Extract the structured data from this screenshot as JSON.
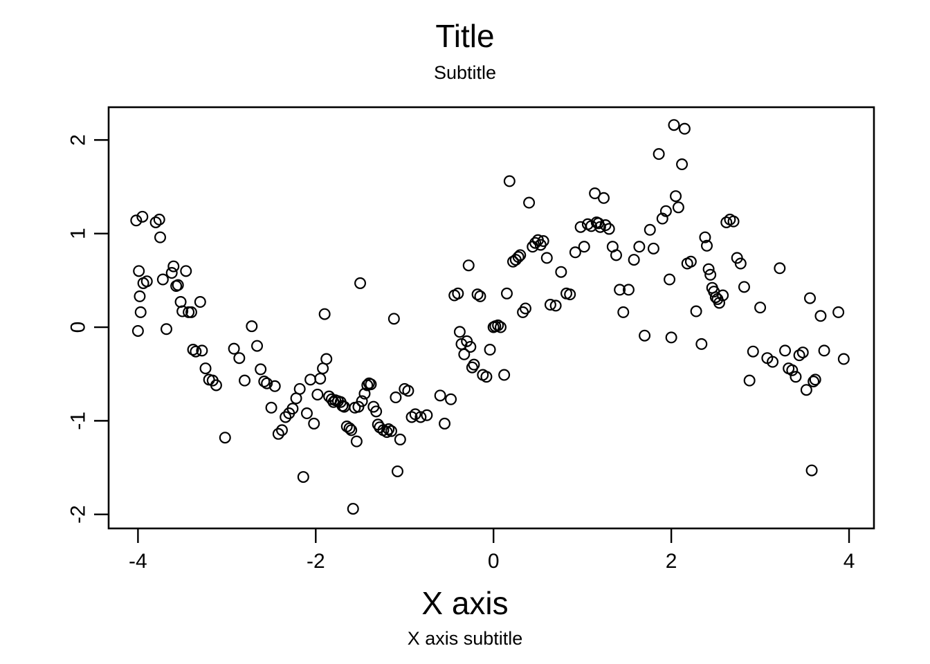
{
  "titles": {
    "main": "Title",
    "sub": "Subtitle",
    "xlab": "X axis",
    "xsublab": "X axis subtitle"
  },
  "colors": {
    "point_stroke": "#000000",
    "axis": "#000000",
    "background": "#ffffff"
  },
  "chart_data": {
    "type": "scatter",
    "title": "Title",
    "subtitle": "Subtitle",
    "xlabel": "X axis",
    "xsublabel": "X axis subtitle",
    "ylabel": "",
    "grid": false,
    "legend": null,
    "marker": "open-circle",
    "xlim": [
      -4.33,
      4.28
    ],
    "ylim": [
      -2.15,
      2.35
    ],
    "xticks": [
      -4,
      -2,
      0,
      2,
      4
    ],
    "yticks": [
      -2,
      -1,
      0,
      1,
      2
    ],
    "xtick_labels": [
      "-4",
      "-2",
      "0",
      "2",
      "4"
    ],
    "ytick_labels": [
      "-2",
      "-1",
      "0",
      "1",
      "2"
    ],
    "n_points": 200,
    "points": [
      [
        -4.02,
        1.14
      ],
      [
        -3.95,
        1.18
      ],
      [
        -3.99,
        0.6
      ],
      [
        -3.94,
        0.47
      ],
      [
        -3.9,
        0.49
      ],
      [
        -3.98,
        0.33
      ],
      [
        -3.97,
        0.16
      ],
      [
        -4.0,
        -0.04
      ],
      [
        -3.8,
        1.12
      ],
      [
        -3.76,
        1.15
      ],
      [
        -3.75,
        0.96
      ],
      [
        -3.72,
        0.51
      ],
      [
        -3.6,
        0.65
      ],
      [
        -3.62,
        0.58
      ],
      [
        -3.57,
        0.44
      ],
      [
        -3.55,
        0.45
      ],
      [
        -3.52,
        0.27
      ],
      [
        -3.5,
        0.17
      ],
      [
        -3.46,
        0.6
      ],
      [
        -3.43,
        0.16
      ],
      [
        -3.4,
        0.16
      ],
      [
        -3.38,
        -0.24
      ],
      [
        -3.35,
        -0.26
      ],
      [
        -3.3,
        0.27
      ],
      [
        -3.28,
        -0.25
      ],
      [
        -3.24,
        -0.44
      ],
      [
        -3.2,
        -0.56
      ],
      [
        -3.16,
        -0.57
      ],
      [
        -3.12,
        -0.62
      ],
      [
        -3.02,
        -1.18
      ],
      [
        -2.92,
        -0.23
      ],
      [
        -2.86,
        -0.33
      ],
      [
        -2.8,
        -0.57
      ],
      [
        -2.72,
        0.01
      ],
      [
        -2.66,
        -0.2
      ],
      [
        -2.62,
        -0.45
      ],
      [
        -2.58,
        -0.58
      ],
      [
        -2.55,
        -0.6
      ],
      [
        -2.5,
        -0.86
      ],
      [
        -2.46,
        -0.63
      ],
      [
        -2.42,
        -1.14
      ],
      [
        -2.38,
        -1.1
      ],
      [
        -2.34,
        -0.96
      ],
      [
        -2.3,
        -0.92
      ],
      [
        -2.26,
        -0.87
      ],
      [
        -2.22,
        -0.76
      ],
      [
        -2.18,
        -0.66
      ],
      [
        -2.14,
        -1.6
      ],
      [
        -2.1,
        -0.92
      ],
      [
        -2.06,
        -0.56
      ],
      [
        -2.02,
        -1.03
      ],
      [
        -1.98,
        -0.72
      ],
      [
        -1.95,
        -0.55
      ],
      [
        -1.92,
        -0.44
      ],
      [
        -1.9,
        0.14
      ],
      [
        -1.88,
        -0.34
      ],
      [
        -1.85,
        -0.74
      ],
      [
        -1.82,
        -0.77
      ],
      [
        -1.8,
        -0.8
      ],
      [
        -1.78,
        -0.78
      ],
      [
        -1.75,
        -0.79
      ],
      [
        -1.72,
        -0.8
      ],
      [
        -1.7,
        -0.84
      ],
      [
        -1.68,
        -0.85
      ],
      [
        -1.65,
        -1.06
      ],
      [
        -1.62,
        -1.08
      ],
      [
        -1.6,
        -1.1
      ],
      [
        -1.58,
        -1.94
      ],
      [
        -1.56,
        -0.86
      ],
      [
        -1.54,
        -1.22
      ],
      [
        -1.52,
        -0.85
      ],
      [
        -1.5,
        0.47
      ],
      [
        -1.48,
        -0.79
      ],
      [
        -1.45,
        -0.71
      ],
      [
        -1.42,
        -0.62
      ],
      [
        -1.4,
        -0.6
      ],
      [
        -1.38,
        -0.61
      ],
      [
        -1.35,
        -0.85
      ],
      [
        -1.32,
        -0.9
      ],
      [
        -1.3,
        -1.04
      ],
      [
        -1.28,
        -1.07
      ],
      [
        -1.24,
        -1.1
      ],
      [
        -1.2,
        -1.12
      ],
      [
        -1.18,
        -1.09
      ],
      [
        -1.15,
        -1.11
      ],
      [
        -1.12,
        0.09
      ],
      [
        -1.1,
        -0.75
      ],
      [
        -1.08,
        -1.54
      ],
      [
        -1.05,
        -1.2
      ],
      [
        -1.0,
        -0.66
      ],
      [
        -0.96,
        -0.68
      ],
      [
        -0.92,
        -0.96
      ],
      [
        -0.88,
        -0.93
      ],
      [
        -0.82,
        -0.96
      ],
      [
        -0.75,
        -0.94
      ],
      [
        -0.6,
        -0.73
      ],
      [
        -0.55,
        -1.03
      ],
      [
        -0.48,
        -0.77
      ],
      [
        -0.44,
        0.34
      ],
      [
        -0.4,
        0.36
      ],
      [
        -0.38,
        -0.05
      ],
      [
        -0.36,
        -0.18
      ],
      [
        -0.33,
        -0.29
      ],
      [
        -0.3,
        -0.15
      ],
      [
        -0.28,
        0.66
      ],
      [
        -0.26,
        -0.21
      ],
      [
        -0.24,
        -0.43
      ],
      [
        -0.22,
        -0.4
      ],
      [
        -0.18,
        0.35
      ],
      [
        -0.15,
        0.33
      ],
      [
        -0.12,
        -0.51
      ],
      [
        -0.08,
        -0.53
      ],
      [
        -0.04,
        -0.24
      ],
      [
        0.0,
        0.0
      ],
      [
        0.02,
        0.01
      ],
      [
        0.05,
        0.02
      ],
      [
        0.08,
        0.0
      ],
      [
        0.12,
        -0.51
      ],
      [
        0.15,
        0.36
      ],
      [
        0.18,
        1.56
      ],
      [
        0.22,
        0.7
      ],
      [
        0.25,
        0.72
      ],
      [
        0.28,
        0.75
      ],
      [
        0.3,
        0.77
      ],
      [
        0.33,
        0.16
      ],
      [
        0.36,
        0.2
      ],
      [
        0.4,
        1.33
      ],
      [
        0.44,
        0.86
      ],
      [
        0.47,
        0.9
      ],
      [
        0.5,
        0.93
      ],
      [
        0.53,
        0.88
      ],
      [
        0.56,
        0.92
      ],
      [
        0.6,
        0.74
      ],
      [
        0.64,
        0.24
      ],
      [
        0.7,
        0.23
      ],
      [
        0.76,
        0.59
      ],
      [
        0.82,
        0.36
      ],
      [
        0.86,
        0.35
      ],
      [
        0.92,
        0.8
      ],
      [
        0.98,
        1.07
      ],
      [
        1.02,
        0.86
      ],
      [
        1.06,
        1.1
      ],
      [
        1.1,
        1.08
      ],
      [
        1.14,
        1.43
      ],
      [
        1.16,
        1.12
      ],
      [
        1.18,
        1.11
      ],
      [
        1.2,
        1.07
      ],
      [
        1.24,
        1.38
      ],
      [
        1.26,
        1.09
      ],
      [
        1.3,
        1.05
      ],
      [
        1.34,
        0.86
      ],
      [
        1.38,
        0.77
      ],
      [
        1.42,
        0.4
      ],
      [
        1.46,
        0.16
      ],
      [
        1.52,
        0.4
      ],
      [
        1.58,
        0.72
      ],
      [
        1.64,
        0.86
      ],
      [
        1.7,
        -0.09
      ],
      [
        1.76,
        1.04
      ],
      [
        1.8,
        0.84
      ],
      [
        1.86,
        1.85
      ],
      [
        1.9,
        1.16
      ],
      [
        1.94,
        1.24
      ],
      [
        1.98,
        0.51
      ],
      [
        2.0,
        -0.11
      ],
      [
        2.03,
        2.16
      ],
      [
        2.05,
        1.4
      ],
      [
        2.08,
        1.28
      ],
      [
        2.12,
        1.74
      ],
      [
        2.15,
        2.12
      ],
      [
        2.18,
        0.68
      ],
      [
        2.22,
        0.7
      ],
      [
        2.28,
        0.17
      ],
      [
        2.34,
        -0.18
      ],
      [
        2.38,
        0.96
      ],
      [
        2.4,
        0.87
      ],
      [
        2.42,
        0.62
      ],
      [
        2.44,
        0.56
      ],
      [
        2.46,
        0.42
      ],
      [
        2.48,
        0.38
      ],
      [
        2.5,
        0.32
      ],
      [
        2.52,
        0.3
      ],
      [
        2.54,
        0.26
      ],
      [
        2.58,
        0.34
      ],
      [
        2.62,
        1.12
      ],
      [
        2.66,
        1.15
      ],
      [
        2.7,
        1.13
      ],
      [
        2.74,
        0.74
      ],
      [
        2.78,
        0.68
      ],
      [
        2.82,
        0.43
      ],
      [
        2.88,
        -0.57
      ],
      [
        2.92,
        -0.26
      ],
      [
        3.0,
        0.21
      ],
      [
        3.08,
        -0.33
      ],
      [
        3.14,
        -0.37
      ],
      [
        3.22,
        0.63
      ],
      [
        3.28,
        -0.25
      ],
      [
        3.32,
        -0.44
      ],
      [
        3.36,
        -0.46
      ],
      [
        3.4,
        -0.53
      ],
      [
        3.44,
        -0.3
      ],
      [
        3.48,
        -0.27
      ],
      [
        3.52,
        -0.67
      ],
      [
        3.56,
        0.31
      ],
      [
        3.58,
        -1.53
      ],
      [
        3.6,
        -0.58
      ],
      [
        3.62,
        -0.56
      ],
      [
        3.68,
        0.12
      ],
      [
        3.72,
        -0.25
      ],
      [
        3.88,
        0.16
      ],
      [
        3.94,
        -0.34
      ],
      [
        -3.68,
        -0.02
      ]
    ]
  }
}
